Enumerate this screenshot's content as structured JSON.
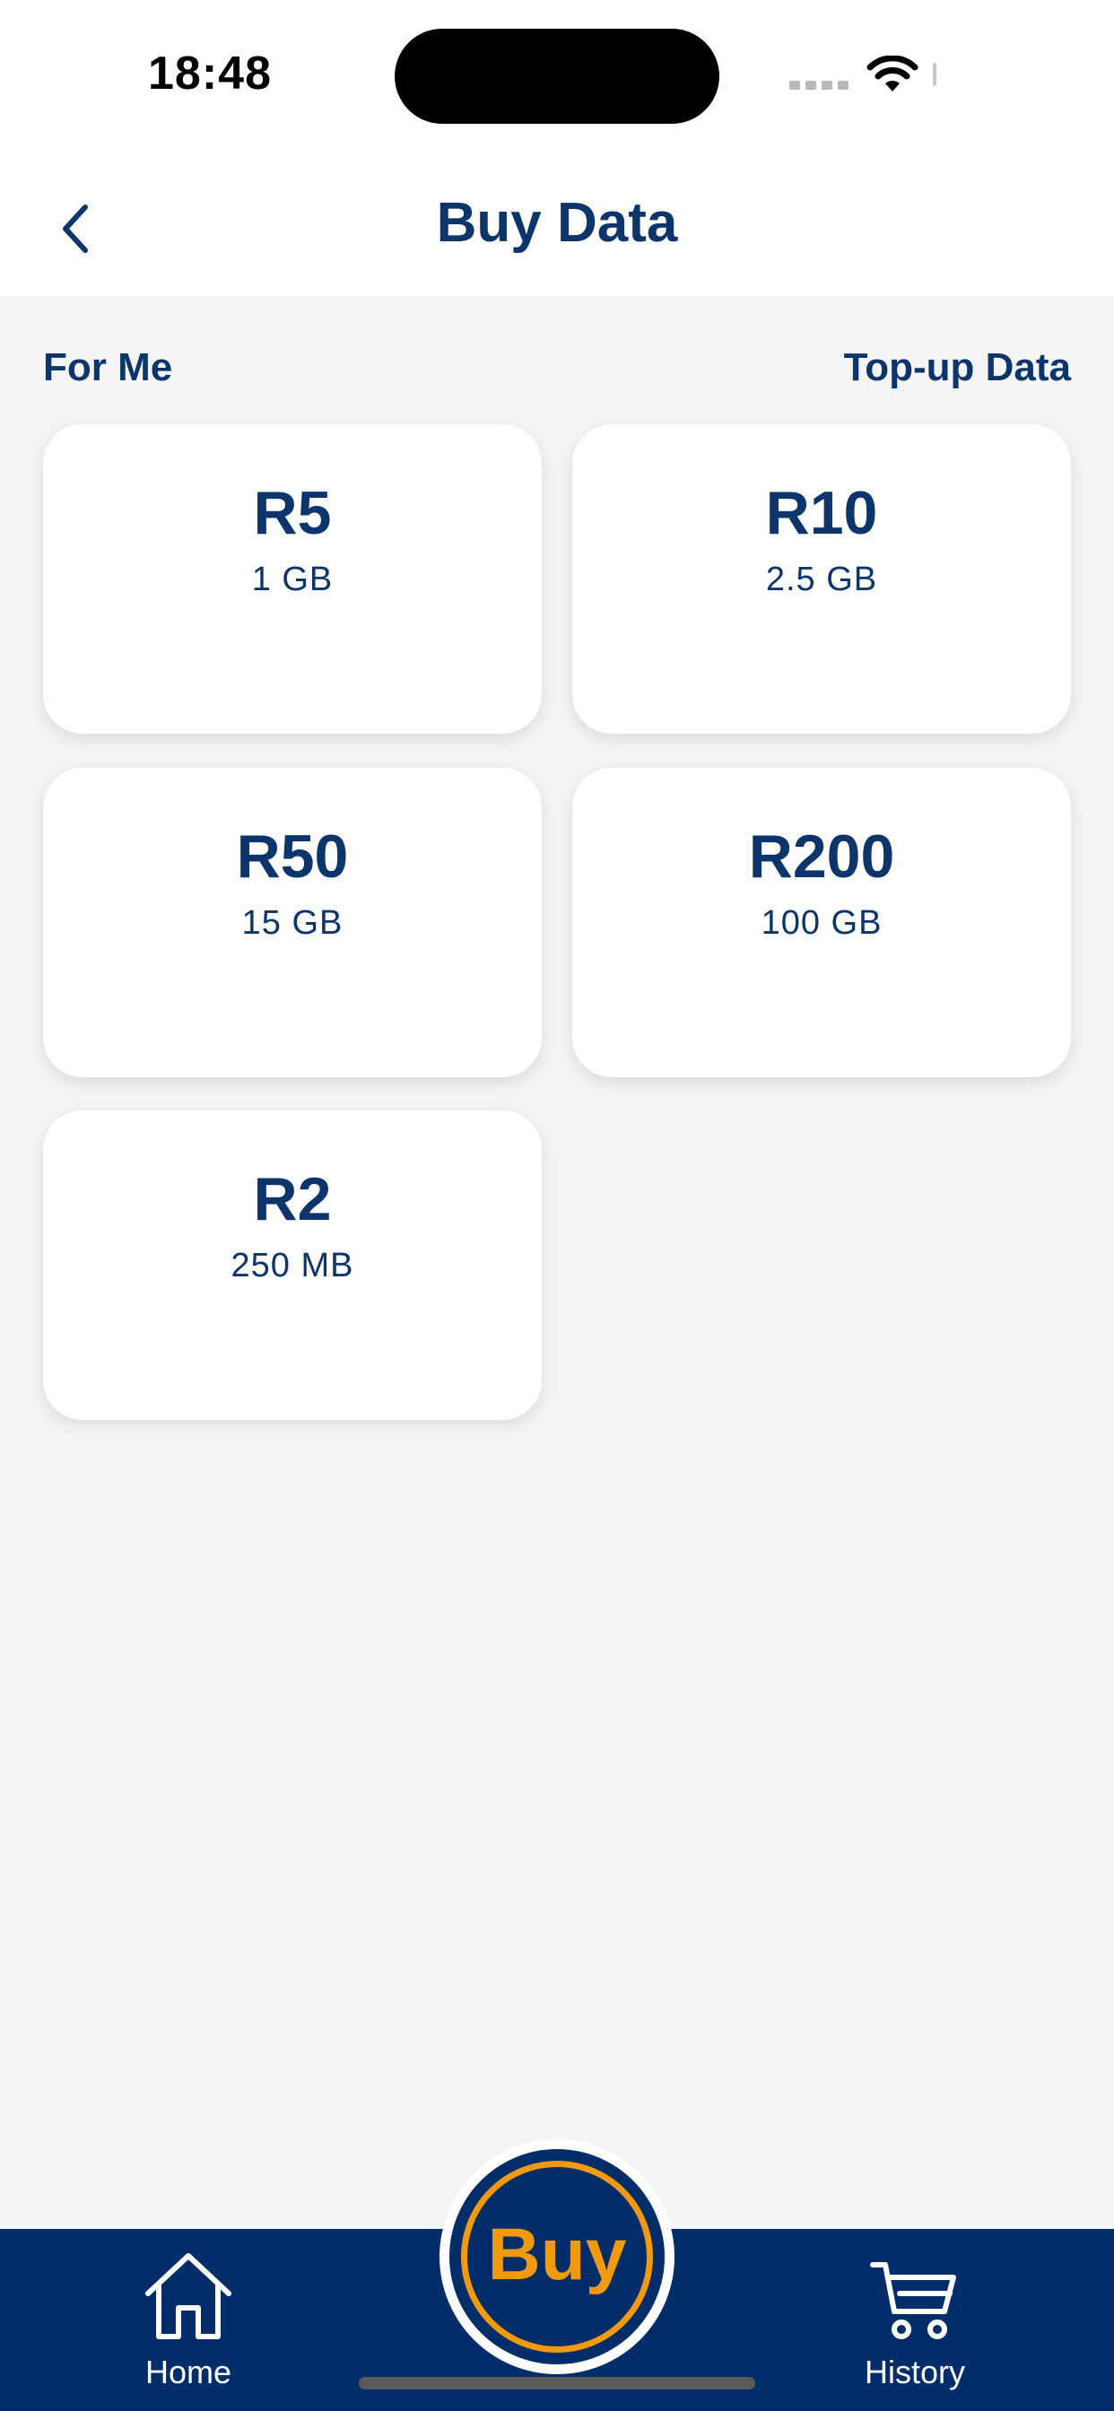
{
  "status_bar": {
    "time": "18:48"
  },
  "header": {
    "title": "Buy Data"
  },
  "section": {
    "left_label": "For Me",
    "right_label": "Top-up Data"
  },
  "bundles": [
    {
      "price": "R5",
      "volume": "1 GB"
    },
    {
      "price": "R10",
      "volume": "2.5 GB"
    },
    {
      "price": "R50",
      "volume": "15 GB"
    },
    {
      "price": "R200",
      "volume": "100 GB"
    },
    {
      "price": "R2",
      "volume": "250 MB"
    }
  ],
  "tab_bar": {
    "home_label": "Home",
    "buy_label": "Buy",
    "history_label": "History"
  },
  "colors": {
    "primary": "#0b356b",
    "tab_bar": "#012d68",
    "accent": "#f29a0f",
    "background": "#f4f4f4"
  },
  "icons": [
    "back-chevron-icon",
    "wifi-icon",
    "home-icon",
    "cart-icon"
  ]
}
